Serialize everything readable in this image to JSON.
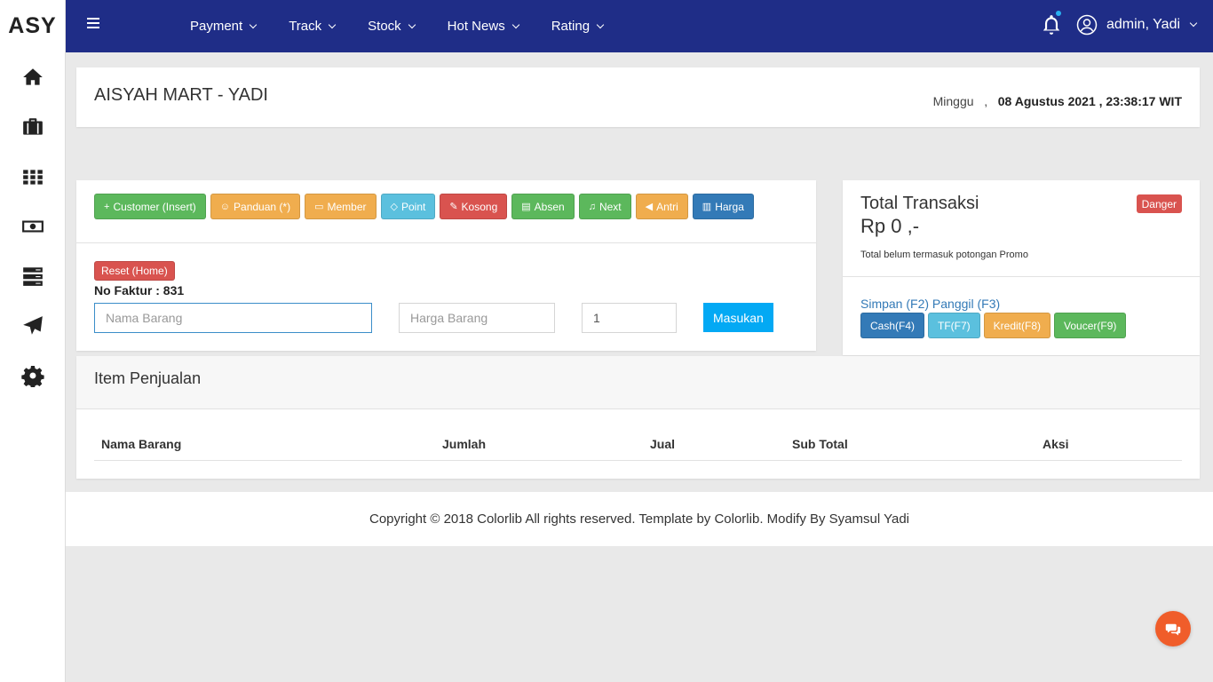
{
  "brand": "ASY",
  "sidebar": {
    "items": [
      {
        "icon": "home-icon"
      },
      {
        "icon": "briefcase-icon"
      },
      {
        "icon": "grid-icon"
      },
      {
        "icon": "money-icon"
      },
      {
        "icon": "server-icon"
      },
      {
        "icon": "send-icon"
      },
      {
        "icon": "gear-icon"
      }
    ]
  },
  "topbar": {
    "menu": [
      {
        "label": "Payment"
      },
      {
        "label": "Track"
      },
      {
        "label": "Stock"
      },
      {
        "label": "Hot News"
      },
      {
        "label": "Rating"
      }
    ],
    "user_name": "admin, Yadi",
    "bg_color": "#1f2d87"
  },
  "header": {
    "store_title": "AISYAH MART - YADI",
    "day": "Minggu",
    "separator": ",",
    "datetime": "08 Agustus 2021 , 23:38:17 WIT"
  },
  "actions": {
    "buttons": [
      {
        "label": "Customer (Insert)",
        "icon": "+",
        "color": "green"
      },
      {
        "label": "Panduan (*)",
        "icon": "☺",
        "color": "orange"
      },
      {
        "label": "Member",
        "icon": "▭",
        "color": "orange"
      },
      {
        "label": "Point",
        "icon": "◇",
        "color": "cyan"
      },
      {
        "label": "Kosong",
        "icon": "✎",
        "color": "red"
      },
      {
        "label": "Absen",
        "icon": "▤",
        "color": "green"
      },
      {
        "label": "Next",
        "icon": "♫",
        "color": "green"
      },
      {
        "label": "Antri",
        "icon": "◀",
        "color": "orange"
      },
      {
        "label": "Harga",
        "icon": "▥",
        "color": "blue"
      }
    ],
    "reset_label": "Reset (Home)",
    "faktur_label": "No Faktur : 831",
    "nama_placeholder": "Nama Barang",
    "harga_placeholder": "Harga Barang",
    "qty_value": "1",
    "masukan_label": "Masukan"
  },
  "total": {
    "title": "Total Transaksi",
    "amount": "Rp 0 ,-",
    "badge": "Danger",
    "note": "Total belum termasuk potongan Promo",
    "simpan": "Simpan (F2)",
    "panggil": "Panggil (F3)",
    "pay_buttons": [
      {
        "label": "Cash(F4)",
        "color": "blue"
      },
      {
        "label": "TF(F7)",
        "color": "cyan"
      },
      {
        "label": "Kredit(F8)",
        "color": "orange"
      },
      {
        "label": "Voucer(F9)",
        "color": "green"
      }
    ]
  },
  "items": {
    "title": "Item Penjualan",
    "columns": [
      "Nama Barang",
      "Jumlah",
      "Jual",
      "Sub Total",
      "Aksi"
    ]
  },
  "footer": {
    "text": "Copyright © 2018 Colorlib All rights reserved. Template by Colorlib. Modify By Syamsul Yadi"
  },
  "chat_fab": {
    "icon": "chat-icon",
    "color": "#f05d2a"
  }
}
